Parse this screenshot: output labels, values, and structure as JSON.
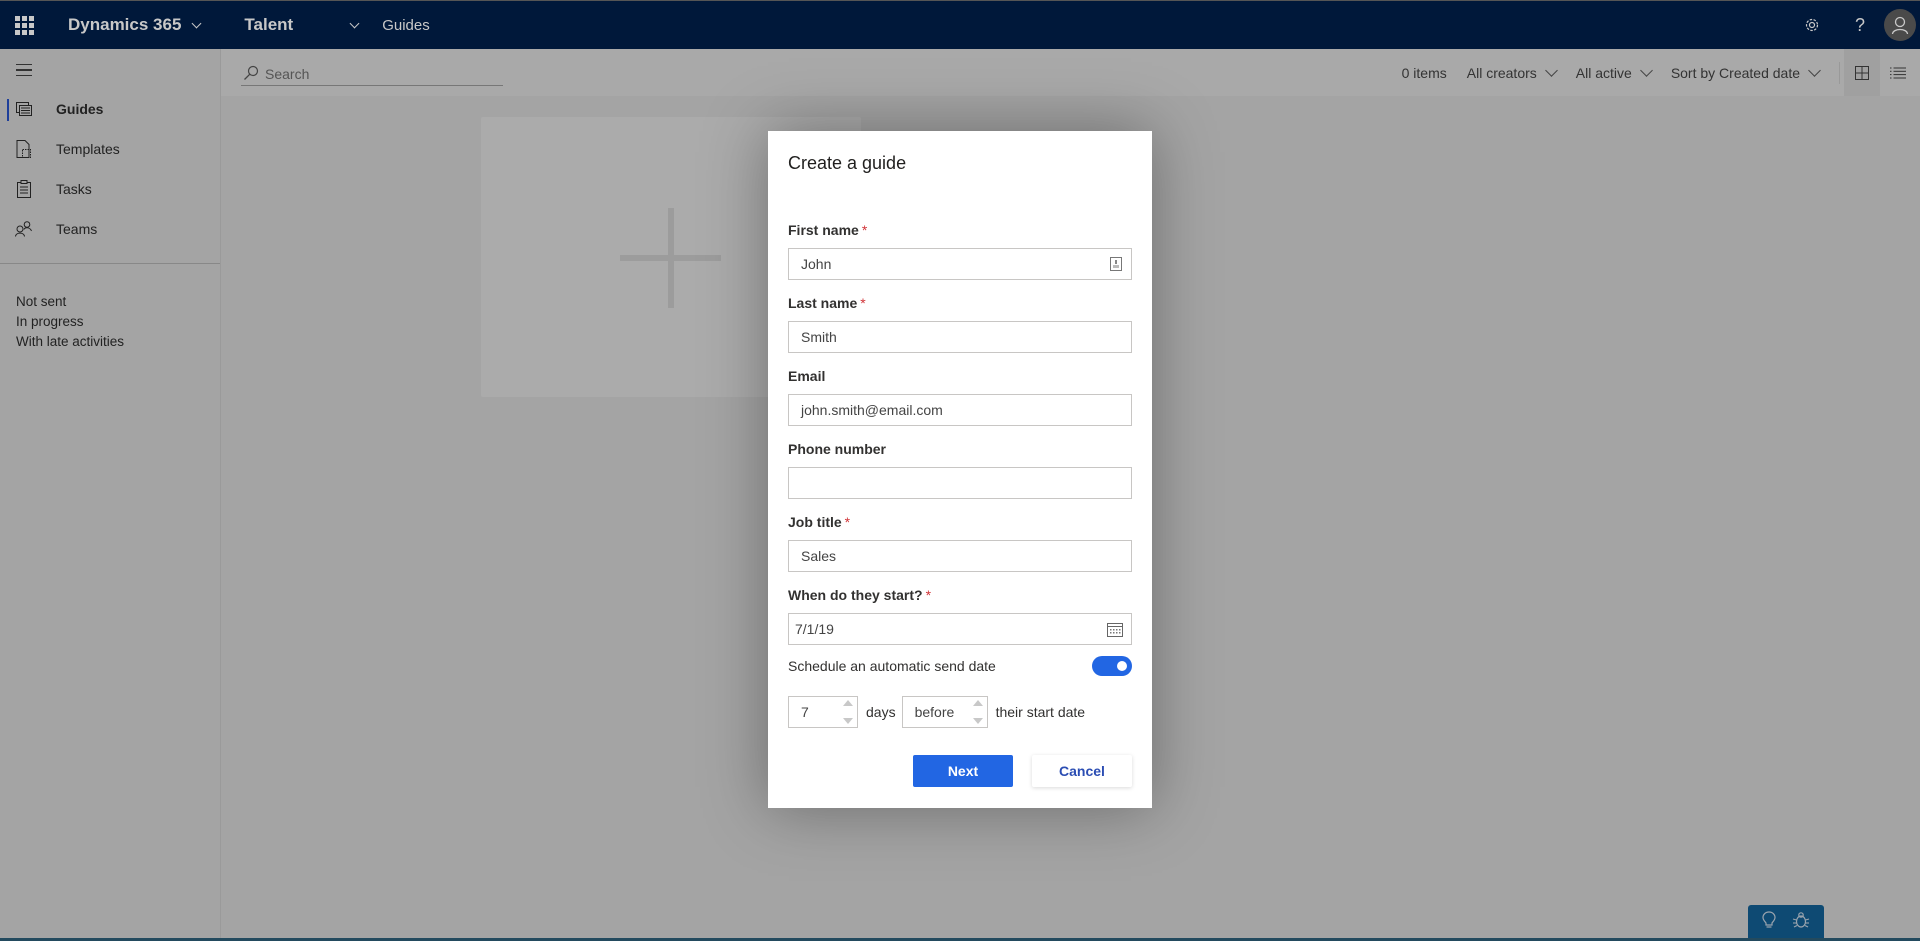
{
  "topbar": {
    "app_name": "Dynamics 365",
    "module": "Talent",
    "breadcrumb": "Guides",
    "icons": [
      "waffle-icon",
      "settings-icon",
      "help-icon",
      "user-avatar-icon"
    ],
    "help_glyph": "?"
  },
  "sidebar": {
    "items": [
      {
        "label": "Guides",
        "icon": "guides-icon",
        "active": true
      },
      {
        "label": "Templates",
        "icon": "templates-icon",
        "active": false
      },
      {
        "label": "Tasks",
        "icon": "tasks-icon",
        "active": false
      },
      {
        "label": "Teams",
        "icon": "teams-icon",
        "active": false
      }
    ],
    "filters": [
      "Not sent",
      "In progress",
      "With late activities"
    ]
  },
  "toolbar": {
    "search_placeholder": "Search",
    "item_count": "0 items",
    "creator_filter": "All creators",
    "status_filter": "All active",
    "sort": "Sort by Created date",
    "views": [
      "grid-view",
      "list-view"
    ],
    "active_view": "grid-view"
  },
  "dialog": {
    "title": "Create a guide",
    "fields": {
      "first_name": {
        "label": "First name",
        "required": "*",
        "value": "John"
      },
      "last_name": {
        "label": "Last name",
        "required": "*",
        "value": "Smith"
      },
      "email": {
        "label": "Email",
        "value": "john.smith@email.com"
      },
      "phone": {
        "label": "Phone number",
        "value": ""
      },
      "job_title": {
        "label": "Job title",
        "required": "*",
        "value": "Sales"
      },
      "start_date": {
        "label": "When do they start?",
        "required": "*",
        "value": "7/1/19"
      }
    },
    "schedule": {
      "label": "Schedule an automatic send date",
      "enabled": true,
      "days_value": "7",
      "days_label": "days",
      "relation_value": "before",
      "suffix": "their start date"
    },
    "buttons": {
      "next": "Next",
      "cancel": "Cancel"
    }
  },
  "colors": {
    "topbar_bg": "#00183a",
    "primary": "#2266e3",
    "required": "#d13438",
    "feedback_bg": "#0e4a73"
  }
}
